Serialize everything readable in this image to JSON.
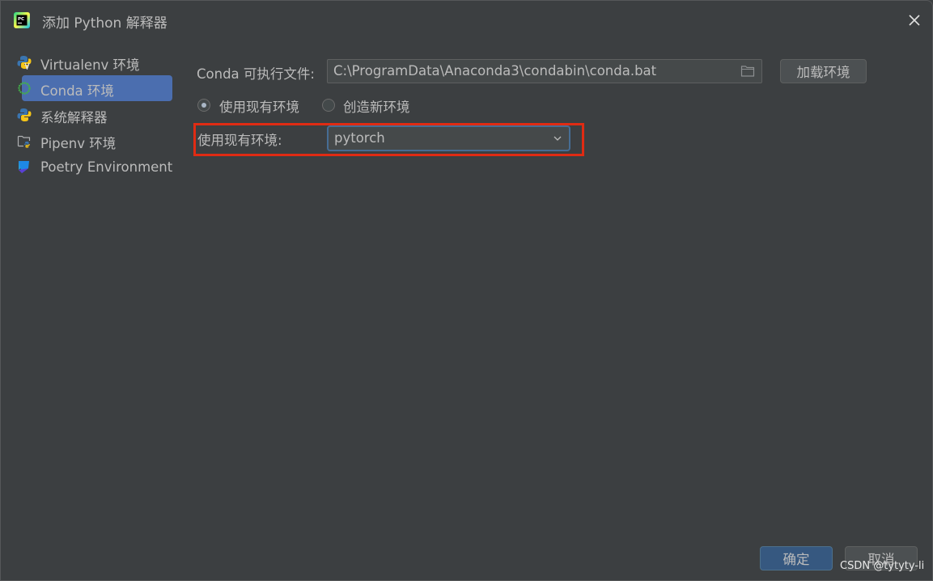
{
  "window": {
    "title": "添加 Python 解释器",
    "app_icon": "pycharm-logo-icon",
    "close_icon": "close-icon"
  },
  "sidebar": {
    "items": [
      {
        "label": "Virtualenv 环境",
        "icon": "virtualenv-icon",
        "selected": false
      },
      {
        "label": "Conda 环境",
        "icon": "conda-icon",
        "selected": true
      },
      {
        "label": "系统解释器",
        "icon": "python-icon",
        "selected": false
      },
      {
        "label": "Pipenv 环境",
        "icon": "pipenv-folder-icon",
        "selected": false
      },
      {
        "label": "Poetry Environment",
        "icon": "poetry-icon",
        "selected": false
      }
    ]
  },
  "main": {
    "conda_exec_label": "Conda 可执行文件:",
    "conda_exec_path": "C:\\ProgramData\\Anaconda3\\condabin\\conda.bat",
    "load_env_button": "加载环境",
    "radio_options": [
      {
        "label": "使用现有环境",
        "checked": true
      },
      {
        "label": "创造新环境",
        "checked": false
      }
    ],
    "existing_env_label": "使用现有环境:",
    "existing_env_value": "pytorch"
  },
  "footer": {
    "ok_button": "确定",
    "cancel_button": "取消"
  },
  "watermark": "CSDN @tytyty-li",
  "colors": {
    "background": "#3c3f41",
    "selected": "#4b6eaf",
    "primary_button": "#365880",
    "highlight_box": "#e02b13",
    "focus_border": "#466d94"
  }
}
